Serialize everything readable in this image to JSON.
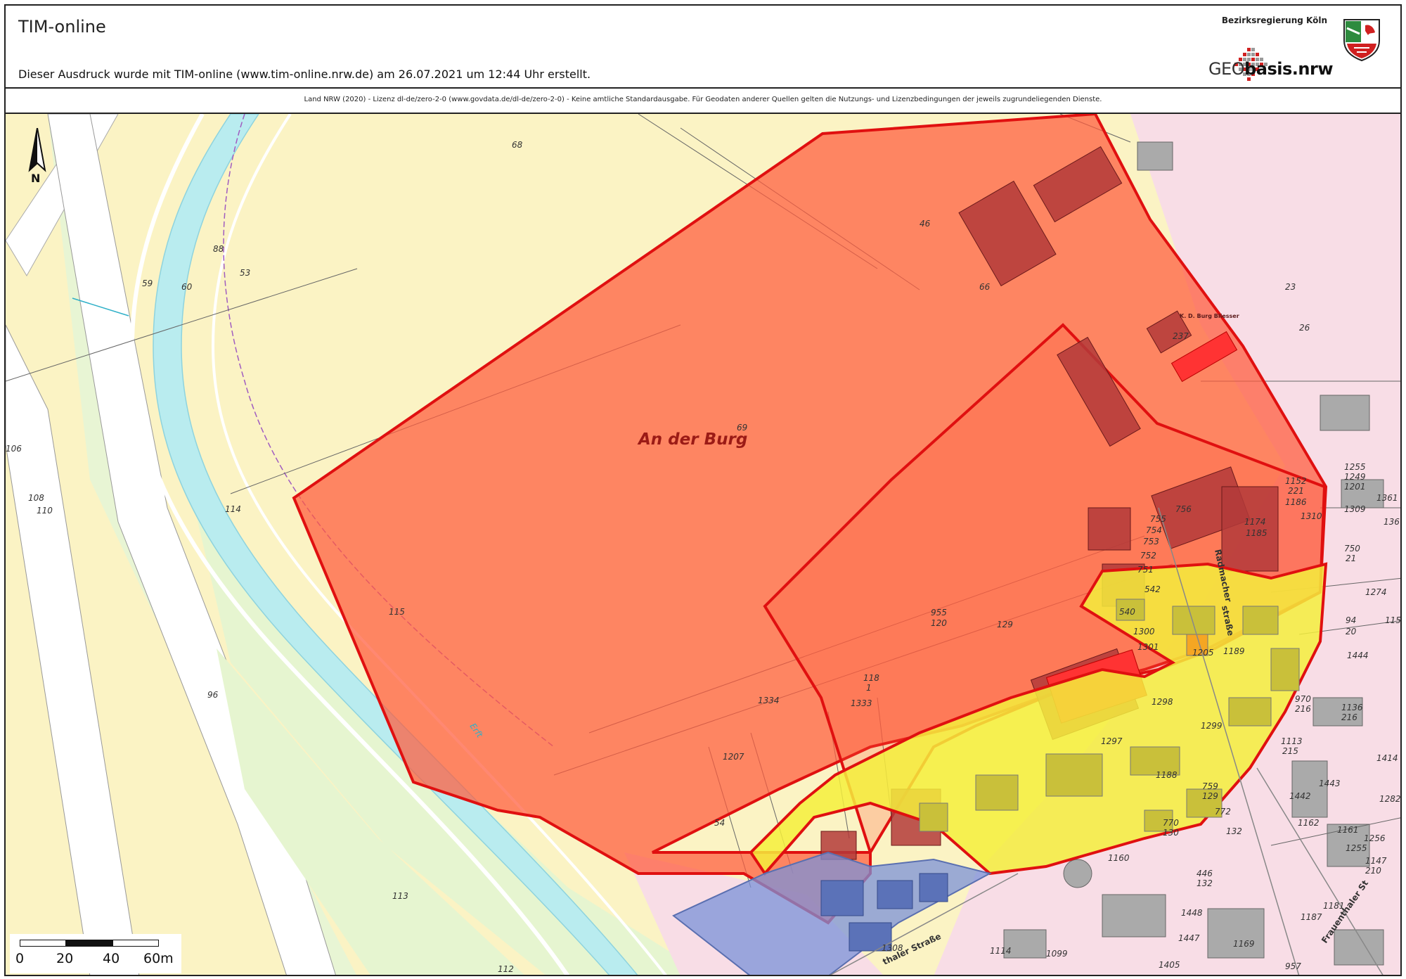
{
  "header": {
    "app_title": "TIM-online",
    "print_note": "Dieser Ausdruck wurde mit TIM-online (www.tim-online.nrw.de) am 26.07.2021 um 12:44 Uhr erstellt.",
    "authority": "Bezirksregierung Köln",
    "geobasis_prefix": "GEO",
    "geobasis_suffix": "basis.nrw",
    "crest_icon": "nrw-coat-of-arms-icon",
    "geo_dots_icon": "geobasis-dot-logo-icon"
  },
  "license": {
    "text": "Land NRW (2020) - Lizenz dl-de/zero-2-0 (www.govdata.de/dl-de/zero-2-0) - Keine amtliche Standardausgabe. Für Geodaten anderer Quellen gelten die Nutzungs- und Lizenzbedingungen der jeweils zugrundeliegenden Dienste."
  },
  "map": {
    "north_label": "N",
    "north_icon": "north-arrow-icon",
    "locality_label": "An der Burg",
    "river_label": "Erft",
    "street_radmacher_1": "Radmacher",
    "street_radmacher_2": "straße",
    "street_frauenthaler": "Frauenthaler St",
    "street_thaler": "thaler Straße",
    "building_label": "K. D. Burg Bliesser",
    "colors": {
      "zone_red_fill": "#ff5a3c",
      "zone_red_stroke": "#e01010",
      "zone_yellow_fill": "#f5ee3c",
      "zone_blue_fill": "#7b92d8",
      "farmland": "#fbf3c4",
      "meadow": "#e6f5d0",
      "river": "#b9ecef",
      "residential": "#f8dde6"
    },
    "parcel_labels": [
      "68",
      "88",
      "53",
      "59",
      "60",
      "46",
      "66",
      "23",
      "237",
      "26",
      "69",
      "106",
      "108",
      "110",
      "114",
      "115",
      "96",
      "1334",
      "1207",
      "54",
      "113",
      "112",
      "955",
      "120",
      "129",
      "118",
      "1",
      "1333",
      "1297",
      "1298",
      "1299",
      "1188",
      "759",
      "129",
      "770",
      "130",
      "1300",
      "1301",
      "540",
      "542",
      "751",
      "752",
      "753",
      "754",
      "755",
      "756",
      "1255",
      "1249",
      "1201",
      "1361",
      "136",
      "1309",
      "1310",
      "1152",
      "221",
      "1186",
      "1174",
      "1185",
      "750",
      "21",
      "1274",
      "115",
      "94",
      "20",
      "1444",
      "1136",
      "216",
      "970",
      "216",
      "1113",
      "215",
      "1414",
      "1443",
      "1442",
      "1282",
      "1162",
      "1161",
      "1256",
      "1255",
      "1147",
      "210",
      "1181",
      "1187",
      "1448",
      "1447",
      "1169",
      "1405",
      "957",
      "1099",
      "1114",
      "1308",
      "446",
      "132",
      "1189",
      "1205",
      "1160",
      "772",
      "132"
    ]
  },
  "scalebar": {
    "ticks": [
      "0",
      "20",
      "40",
      "60m"
    ]
  }
}
